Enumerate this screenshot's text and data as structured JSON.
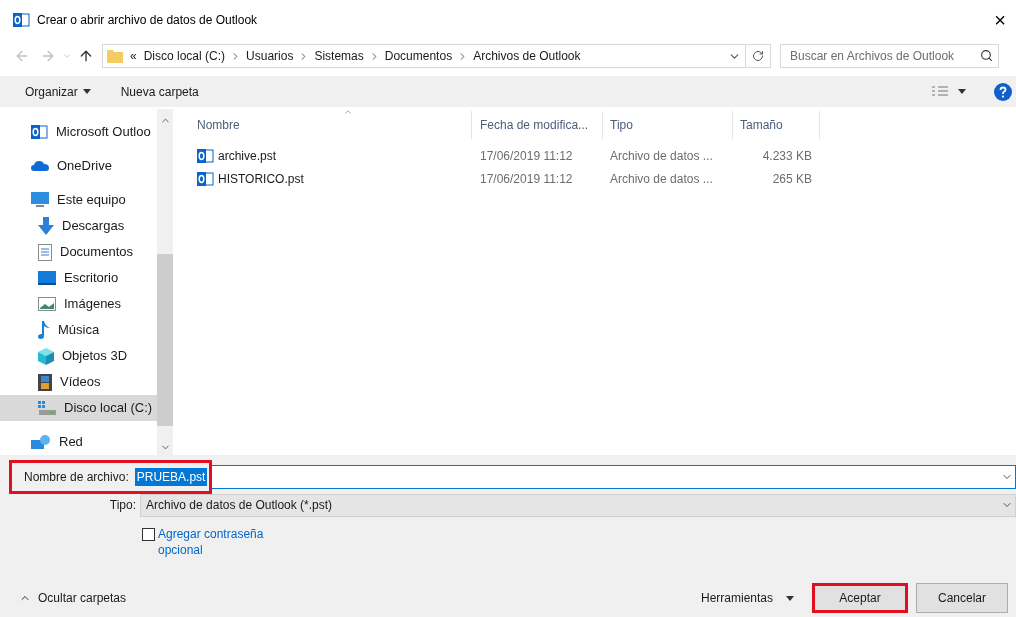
{
  "window": {
    "title": "Crear o abrir archivo de datos de Outlook",
    "close": "×"
  },
  "address": {
    "overflow": "«",
    "path": [
      "Disco local (C:)",
      "Usuarios",
      "Sistemas",
      "Documentos",
      "Archivos de Outlook"
    ]
  },
  "search": {
    "placeholder": "Buscar en Archivos de Outlook"
  },
  "toolbar": {
    "organize": "Organizar",
    "new_folder": "Nueva carpeta"
  },
  "sidebar": {
    "items": [
      {
        "label": "Microsoft Outloo",
        "kind": "outlook",
        "selected": false
      },
      {
        "label": "OneDrive",
        "kind": "cloud",
        "selected": false
      },
      {
        "label": "Este equipo",
        "kind": "pc",
        "selected": false,
        "children": [
          {
            "label": "Descargas",
            "kind": "download",
            "selected": false
          },
          {
            "label": "Documentos",
            "kind": "document",
            "selected": false
          },
          {
            "label": "Escritorio",
            "kind": "desktop",
            "selected": false
          },
          {
            "label": "Imágenes",
            "kind": "pictures",
            "selected": false
          },
          {
            "label": "Música",
            "kind": "music",
            "selected": false
          },
          {
            "label": "Objetos 3D",
            "kind": "cube",
            "selected": false
          },
          {
            "label": "Vídeos",
            "kind": "video",
            "selected": false
          },
          {
            "label": "Disco local (C:)",
            "kind": "drive",
            "selected": true
          }
        ]
      },
      {
        "label": "Red",
        "kind": "network",
        "selected": false
      }
    ]
  },
  "table": {
    "columns": [
      "Nombre",
      "Fecha de modifica...",
      "Tipo",
      "Tamaño"
    ],
    "rows": [
      {
        "name": "archive.pst",
        "modified": "17/06/2019 11:12",
        "type": "Archivo de datos ...",
        "size": "4.233 KB"
      },
      {
        "name": "HISTORICO.pst",
        "modified": "17/06/2019 11:12",
        "type": "Archivo de datos ...",
        "size": "265 KB"
      }
    ]
  },
  "filename": {
    "label": "Nombre de archivo:",
    "value": "PRUEBA.pst",
    "highlighted": true
  },
  "filetype": {
    "label": "Tipo:",
    "value": "Archivo de datos de Outlook (*.pst)"
  },
  "password": {
    "label": "Agregar contraseña opcional",
    "checked": false
  },
  "hide_folders": "Ocultar carpetas",
  "tools": "Herramientas",
  "buttons": [
    {
      "label": "Aceptar",
      "highlighted": true
    },
    {
      "label": "Cancelar",
      "highlighted": false
    }
  ]
}
